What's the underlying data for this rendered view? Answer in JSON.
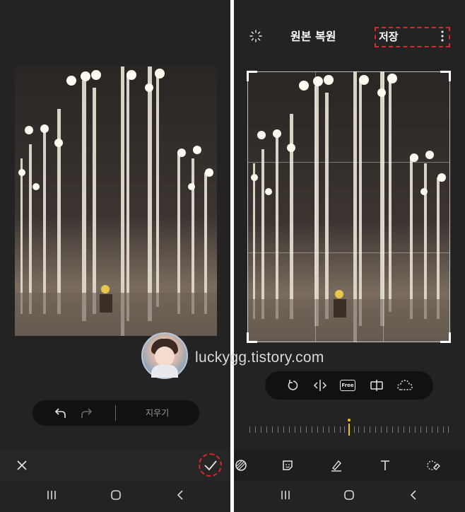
{
  "left": {
    "pill": {
      "erase_label": "지우기"
    }
  },
  "right": {
    "header": {
      "title": "원본 복원",
      "save_label": "저장"
    },
    "tools": {
      "free_label": "Free"
    }
  },
  "overlay": {
    "watermark": "luckygg.tistory.com"
  },
  "colors": {
    "highlight": "#e2252b",
    "accent": "#f2c21c"
  }
}
